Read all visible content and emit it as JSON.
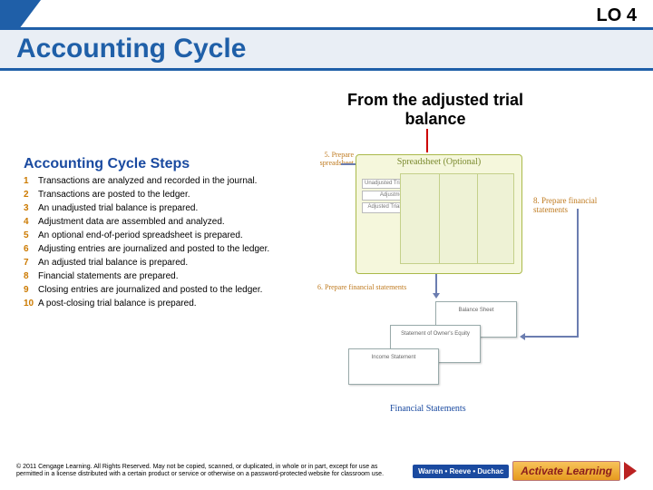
{
  "header": {
    "lo_tag": "LO 4",
    "title": "Accounting Cycle"
  },
  "callout": {
    "text": "From the adjusted trial balance"
  },
  "figure": {
    "title": "Accounting Cycle Steps",
    "steps": [
      "Transactions are analyzed and recorded in the journal.",
      "Transactions are posted to the ledger.",
      "An unadjusted trial balance is prepared.",
      "Adjustment data are assembled and analyzed.",
      "An optional end-of-period spreadsheet is prepared.",
      "Adjusting entries are journalized and posted to the ledger.",
      "An adjusted trial balance is prepared.",
      "Financial statements are prepared.",
      "Closing entries are journalized and posted to the ledger.",
      "A post-closing trial balance is prepared."
    ],
    "spreadsheet": {
      "title": "Spreadsheet (Optional)",
      "mini": [
        "Unadjusted Trial Balance",
        "Adjustments",
        "Adjusted Trial Balance"
      ]
    },
    "labels": {
      "step5": "5. Prepare spreadsheet",
      "step6": "6. Prepare financial statements",
      "step8": "8. Prepare financial statements"
    },
    "financial_statements": {
      "sheets": [
        "Balance Sheet",
        "Statement of Owner's Equity",
        "Income Statement"
      ],
      "caption": "Financial Statements"
    }
  },
  "footer": {
    "copyright": "© 2011 Cengage Learning. All Rights Reserved. May not be copied, scanned, or duplicated, in whole or in part, except for use as permitted in a license distributed with a certain product or service or otherwise on a password-protected website for classroom use.",
    "brand": "Warren • Reeve • Duchac",
    "activate": "Activate Learning"
  }
}
